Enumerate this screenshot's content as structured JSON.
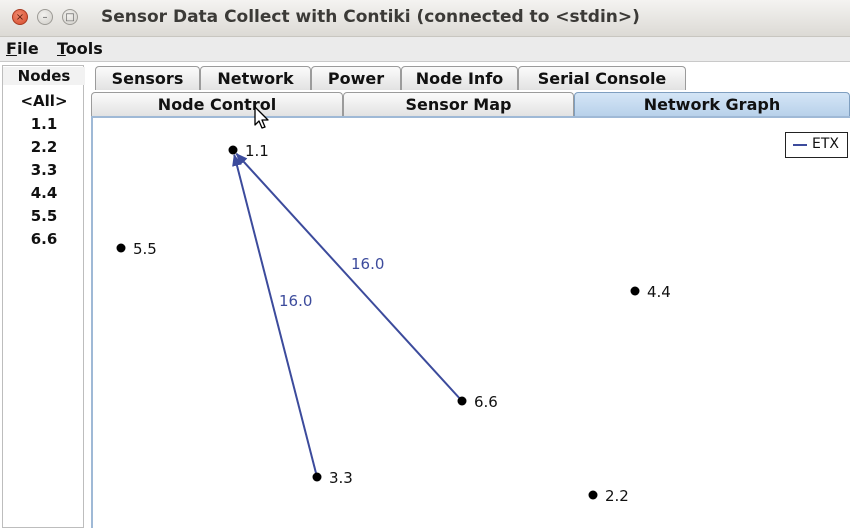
{
  "window": {
    "title": "Sensor Data Collect with Contiki (connected to <stdin>)",
    "close_glyph": "×",
    "minimize_glyph": "–",
    "maximize_glyph": "□"
  },
  "menu": {
    "file": {
      "mnemonic": "F",
      "rest": "ile"
    },
    "tools": {
      "mnemonic": "T",
      "rest": "ools"
    }
  },
  "nodes_panel": {
    "title": "Nodes",
    "items": [
      "<All>",
      "1.1",
      "2.2",
      "3.3",
      "4.4",
      "5.5",
      "6.6"
    ]
  },
  "tabs": {
    "row1": [
      "Sensors",
      "Network",
      "Power",
      "Node Info",
      "Serial Console"
    ],
    "row2": [
      "Node Control",
      "Sensor Map",
      "Network Graph"
    ],
    "selected": "Network Graph"
  },
  "graph": {
    "legend": "ETX",
    "edge_color": "#3c4b9c",
    "node_color": "#000000",
    "nodes": [
      {
        "id": "1.1"
      },
      {
        "id": "5.5"
      },
      {
        "id": "4.4"
      },
      {
        "id": "6.6"
      },
      {
        "id": "3.3"
      },
      {
        "id": "2.2"
      }
    ],
    "edges": [
      {
        "from": "6.6",
        "to": "1.1",
        "label": "16.0"
      },
      {
        "from": "3.3",
        "to": "1.1",
        "label": "16.0"
      }
    ]
  },
  "colors": {
    "selected_tab": "#b8d1ea",
    "content_border": "#9fb9d6"
  }
}
